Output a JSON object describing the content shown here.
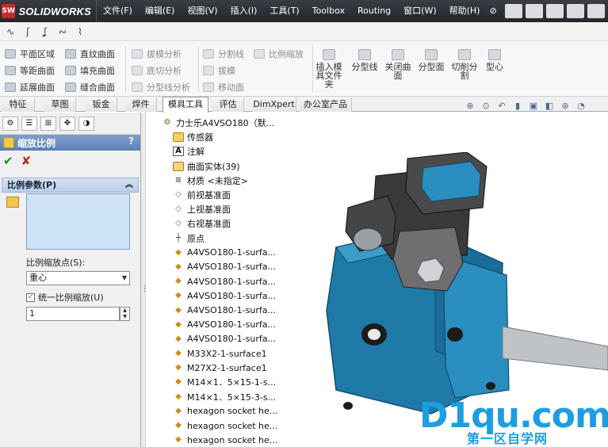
{
  "app": {
    "brand": "SOLIDWORKS",
    "badge": "SW"
  },
  "menu": [
    "文件(F)",
    "编辑(E)",
    "视图(V)",
    "插入(I)",
    "工具(T)",
    "Toolbox",
    "Routing",
    "窗口(W)",
    "帮助(H)"
  ],
  "command_manager": {
    "col1": [
      "平面区域",
      "等距曲面",
      "延展曲面"
    ],
    "col2": [
      "直纹曲面",
      "填充曲面",
      "缝合曲面"
    ],
    "col3": [
      "拔模分析",
      "底切分析",
      "分型线分析"
    ],
    "col4": [
      "分割线",
      "拔模",
      "移动面"
    ],
    "col5": [
      "比例缩放"
    ],
    "big": [
      "插入模具文件夹",
      "分型线",
      "关闭曲面",
      "分型面",
      "切削分割",
      "型心"
    ]
  },
  "tabs": [
    "特征",
    "草图",
    "钣金",
    "焊件",
    "模具工具",
    "评估",
    "DimXpert",
    "办公室产品"
  ],
  "active_tab": "模具工具",
  "property_manager": {
    "title": "缩放比例",
    "help": "?",
    "group_title": "比例参数(P)",
    "scale_point_label": "比例缩放点(S):",
    "scale_point_value": "重心",
    "uniform_label": "统一比例缩放(U)",
    "uniform_checked": true,
    "scale_value": "1"
  },
  "tree": [
    {
      "icon": "root",
      "label": "力士乐A4VSO180（默..."
    },
    {
      "icon": "sensor",
      "label": "传感器"
    },
    {
      "icon": "annotation",
      "label": "注解"
    },
    {
      "icon": "surface-body",
      "label": "曲面实体(39)"
    },
    {
      "icon": "material",
      "label": "材质 <未指定>"
    },
    {
      "icon": "plane",
      "label": "前视基准面"
    },
    {
      "icon": "plane",
      "label": "上视基准面"
    },
    {
      "icon": "plane",
      "label": "右视基准面"
    },
    {
      "icon": "origin",
      "label": "原点"
    },
    {
      "icon": "feature",
      "label": "A4VSO180-1-surfa..."
    },
    {
      "icon": "feature",
      "label": "A4VSO180-1-surfa..."
    },
    {
      "icon": "feature",
      "label": "A4VSO180-1-surfa..."
    },
    {
      "icon": "feature",
      "label": "A4VSO180-1-surfa..."
    },
    {
      "icon": "feature",
      "label": "A4VSO180-1-surfa..."
    },
    {
      "icon": "feature",
      "label": "A4VSO180-1-surfa..."
    },
    {
      "icon": "feature",
      "label": "A4VSO180-1-surfa..."
    },
    {
      "icon": "feature",
      "label": "M33X2-1-surface1"
    },
    {
      "icon": "feature",
      "label": "M27X2-1-surface1"
    },
    {
      "icon": "feature",
      "label": "M14×1．5×15-1-s..."
    },
    {
      "icon": "feature",
      "label": "M14×1．5×15-3-s..."
    },
    {
      "icon": "feature",
      "label": "hexagon socket he..."
    },
    {
      "icon": "feature",
      "label": "hexagon socket he..."
    },
    {
      "icon": "feature",
      "label": "hexagon socket he..."
    }
  ],
  "watermark": {
    "main": "D1qu.com",
    "sub": "第一区自学网"
  },
  "colors": {
    "menubar": "#2f3238",
    "model_blue": "#1f7aa8",
    "model_dark": "#3a3a3a",
    "selection_box": "#cfe3f7",
    "pm_title": "#5b81b4"
  }
}
